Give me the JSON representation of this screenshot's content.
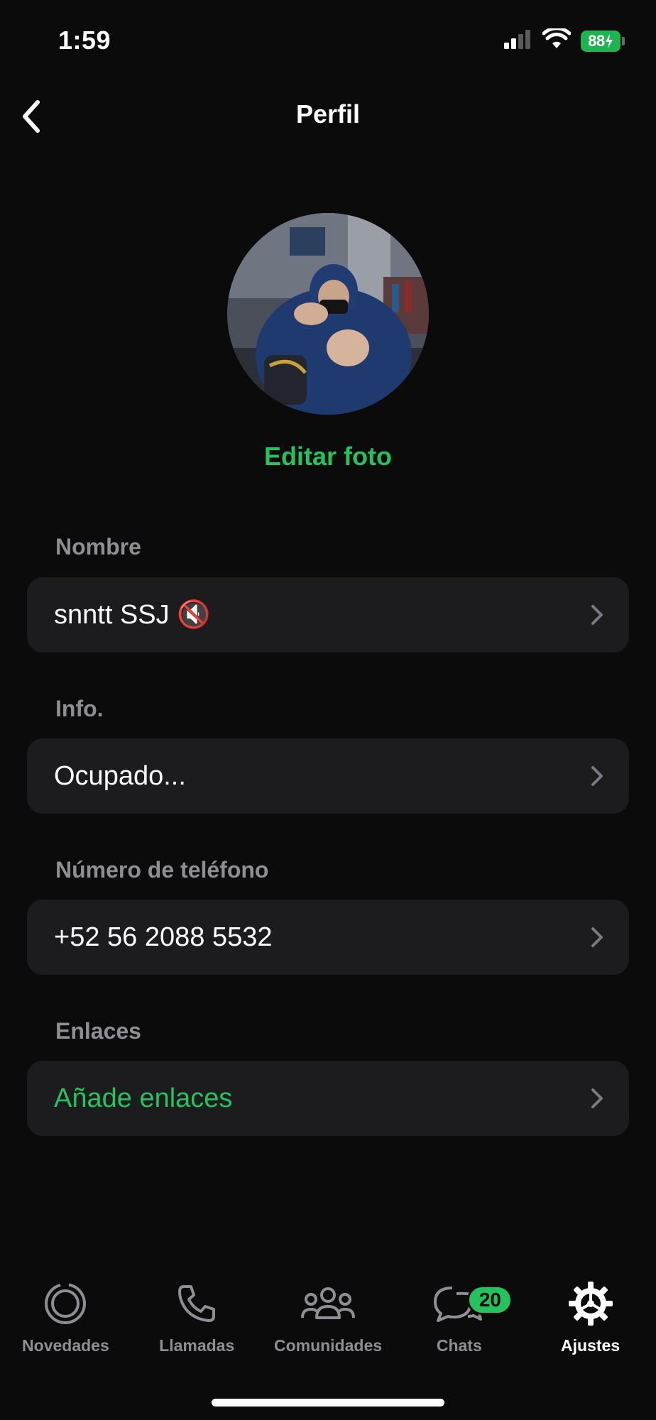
{
  "status_bar": {
    "time": "1:59",
    "battery": "88"
  },
  "header": {
    "title": "Perfil",
    "back_icon": "chevron-left-icon"
  },
  "profile": {
    "edit_photo_label": "Editar foto"
  },
  "sections": {
    "name": {
      "label": "Nombre",
      "value": "snntt SSJ 🔇"
    },
    "info": {
      "label": "Info.",
      "value": "Ocupado..."
    },
    "phone": {
      "label": "Número de teléfono",
      "value": "+52 56 2088 5532"
    },
    "links": {
      "label": "Enlaces",
      "value": "Añade enlaces"
    }
  },
  "tabs": [
    {
      "label": "Novedades",
      "icon": "status-icon"
    },
    {
      "label": "Llamadas",
      "icon": "phone-icon"
    },
    {
      "label": "Comunidades",
      "icon": "communities-icon"
    },
    {
      "label": "Chats",
      "icon": "chats-icon",
      "badge": "20"
    },
    {
      "label": "Ajustes",
      "icon": "settings-icon",
      "active": true
    }
  ],
  "colors": {
    "accent": "#25c25f",
    "background": "#0b0b0b",
    "row": "#1c1c1e",
    "muted": "#8e8e93"
  }
}
